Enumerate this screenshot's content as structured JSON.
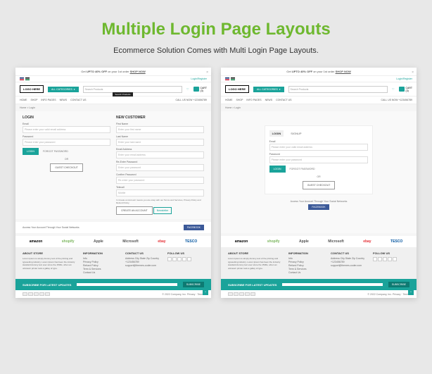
{
  "hero": {
    "title": "Multiple Login Page Layouts",
    "subtitle": "Ecommerce Solution Comes with Multi Login Page Layouts."
  },
  "promo": {
    "prefix": "Get ",
    "bold": "UPTO 40% OFF",
    "suffix": " on your 1st order ",
    "cta": "SHOP NOW"
  },
  "topbar": {
    "login": "Login/Register",
    "currency": "USD"
  },
  "header": {
    "logo": "LOGO HERE",
    "cat": "ALL CATEGORIES",
    "searchPh": "Search Products",
    "tooltip": "Search Products",
    "cart": "CART",
    "cartCount": "(3)"
  },
  "nav": {
    "items": [
      "HOME",
      "SHOP",
      "INFO PAGES",
      "NEWS",
      "CONTACT US"
    ],
    "phone": "CALL US NOW   +123456789"
  },
  "crumb": "Home > Login",
  "login": {
    "title": "LOGIN",
    "emailL": "Email",
    "emailPh": "Please enter your valid email address",
    "passL": "Password",
    "passPh": "Please enter your password",
    "btn": "LOGIN",
    "forgot": "FORGOT PASSWORD",
    "or": "OR",
    "guest": "GUEST CHECKOUT"
  },
  "newcust": {
    "title": "NEW CUSTOMER",
    "fnL": "First Name",
    "fnPh": "Enter your first name",
    "lnL": "Last Name",
    "lnPh": "Enter your last name",
    "emL": "Email Address",
    "emPh": "Enter your email address",
    "pwL": "Re-Enter Password",
    "pwPh": "Enter your password",
    "cpL": "Confirm Password",
    "cpPh": "Re-enter your password",
    "tL": "Telecall",
    "tPh": "Mobile",
    "terms": "In Create an Account means you are okay with our Terms and Services, Privacy Policy and Refund Policy.",
    "btn": "CREATE AN ACCOUNT",
    "newsletter": "Newsletter"
  },
  "social": {
    "text": "Access Your Account Through Your Social Networks",
    "fb": "FACEBOOK"
  },
  "brands": [
    "amazon",
    "shopify",
    "Apple",
    "Microsoft",
    "ebay",
    "TESCO"
  ],
  "footer": {
    "about": {
      "h": "ABOUT STORE",
      "t": "Lorem Ipsum is simply dummy text of the printing and typesetting industry. Lorem Ipsum has been the industry standard dummy text ever since the 1500s, when an unknown printer took a galley of type."
    },
    "info": {
      "h": "INFORMATION",
      "items": [
        "Info",
        "Privacy Policy",
        "Refund Policy",
        "Term & Services",
        "Contact Us"
      ]
    },
    "contact": {
      "h": "CONTACT US",
      "addr": "Address City State Zip Country",
      "ph": "+123456789",
      "em": "support@themes-coder.com"
    },
    "follow": {
      "h": "FOLLOW US"
    }
  },
  "sub": {
    "label": "SUBSCRIBE FOR LATEST UPDATES",
    "btn": "SUBSCRIBE"
  },
  "copy": "© 2022 Company, Inc. Privacy · Terms",
  "tabs": {
    "login": "LOGIN",
    "signup": "SIGNUP"
  }
}
